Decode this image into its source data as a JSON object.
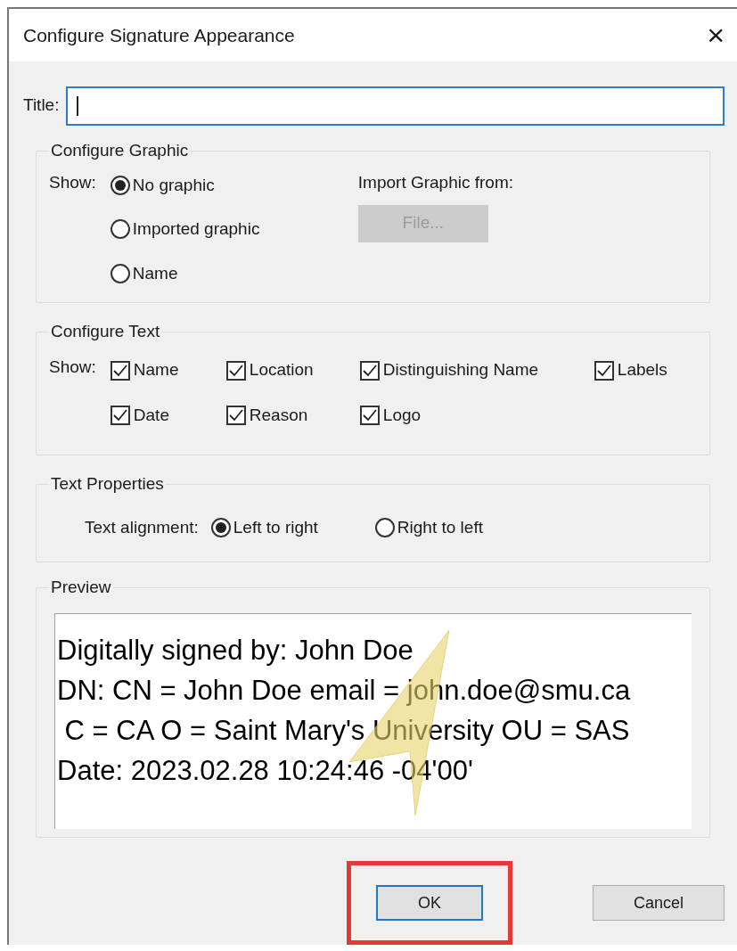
{
  "window": {
    "title": "Configure Signature Appearance",
    "close": "×"
  },
  "title_field": {
    "label": "Title:"
  },
  "configure_graphic": {
    "legend": "Configure Graphic",
    "show_label": "Show:",
    "options": [
      {
        "label": "No graphic",
        "selected": true
      },
      {
        "label": "Imported graphic",
        "selected": false
      },
      {
        "label": "Name",
        "selected": false
      }
    ],
    "import_label": "Import Graphic from:",
    "file_button": {
      "label": "File...",
      "disabled": true
    }
  },
  "configure_text": {
    "legend": "Configure Text",
    "show_label": "Show:",
    "rows": [
      [
        {
          "label": "Name",
          "checked": true
        },
        {
          "label": "Location",
          "checked": true
        },
        {
          "label": "Distinguishing Name",
          "checked": true
        },
        {
          "label": "Labels",
          "checked": true
        }
      ],
      [
        {
          "label": "Date",
          "checked": true
        },
        {
          "label": "Reason",
          "checked": true
        },
        {
          "label": "Logo",
          "checked": true
        }
      ]
    ]
  },
  "text_properties": {
    "legend": "Text Properties",
    "alignment_label": "Text alignment:",
    "options": [
      {
        "label": "Left to right",
        "selected": true
      },
      {
        "label": "Right to left",
        "selected": false
      }
    ]
  },
  "preview": {
    "legend": "Preview",
    "lines": [
      "Digitally signed by: John Doe",
      "DN: CN = John Doe email = john.doe@smu.ca",
      " C = CA O = Saint Mary's University OU = SAS",
      "Date: 2023.02.28 10:24:46 -04'00'"
    ]
  },
  "buttons": [
    {
      "label": "OK",
      "default": true,
      "highlighted": true
    },
    {
      "label": "Cancel",
      "default": false,
      "highlighted": false
    }
  ]
}
